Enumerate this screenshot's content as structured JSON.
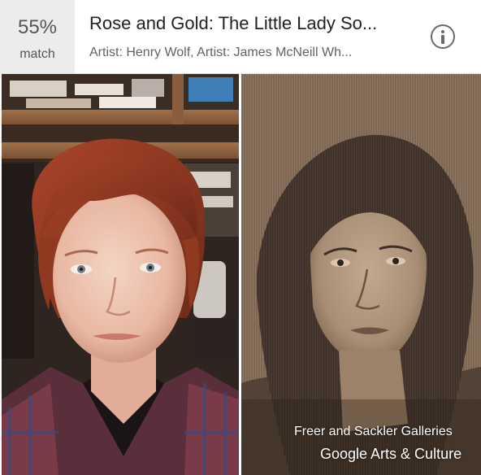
{
  "match": {
    "percent": "55%",
    "label": "match"
  },
  "artwork": {
    "title": "Rose and Gold: The Little Lady So...",
    "artists": "Artist: Henry Wolf,  Artist: James McNeill Wh..."
  },
  "info_button": {
    "icon": "info-icon"
  },
  "left_photo": {
    "description_icon": "selfie-photo"
  },
  "right_photo": {
    "description_icon": "engraved-portrait"
  },
  "credits": {
    "institution": "Freer and Sackler Galleries",
    "platform": "Google Arts & Culture"
  },
  "colors": {
    "match_bg": "#ececec",
    "title_text": "#202124",
    "subtitle_text": "#5f6368"
  }
}
